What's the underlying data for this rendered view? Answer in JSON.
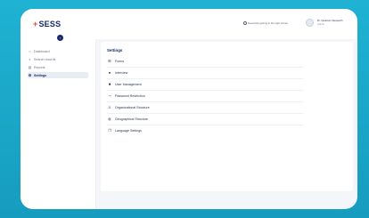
{
  "brand": {
    "plus": "+",
    "name": "SESS"
  },
  "header": {
    "help_text": "Need help getting to the right screen",
    "user_name": "Dr. Quantum Research",
    "user_role": "Admin"
  },
  "sidebar": {
    "collapse_icon": "‹",
    "items": [
      {
        "label": "Dashboard",
        "icon": "home-icon"
      },
      {
        "label": "Search records",
        "icon": "search-icon"
      },
      {
        "label": "Reports",
        "icon": "reports-icon"
      },
      {
        "label": "Settings",
        "icon": "gear-icon",
        "active": true
      }
    ]
  },
  "settings": {
    "title": "Settings",
    "items": [
      {
        "label": "Forms",
        "icon": "forms-icon"
      },
      {
        "label": "Interview",
        "icon": "interview-icon"
      },
      {
        "label": "User Management",
        "icon": "users-icon"
      },
      {
        "label": "Password Restriction",
        "icon": "key-icon"
      },
      {
        "label": "Organizational Structure",
        "icon": "org-icon"
      },
      {
        "label": "Geographical Structure",
        "icon": "globe-icon"
      },
      {
        "label": "Language Settings",
        "icon": "language-icon"
      }
    ]
  },
  "colors": {
    "background": "#1aa7c9",
    "brand_navy": "#1b2a6b",
    "brand_red": "#e2483d",
    "active_bg": "#e8ecf3"
  }
}
